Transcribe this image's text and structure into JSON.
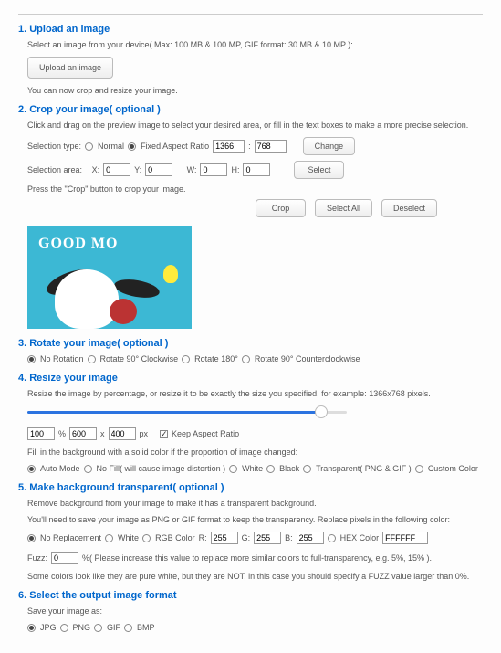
{
  "sec1": {
    "title": "1. Upload an image",
    "desc": "Select an image from your device( Max: 100 MB & 100 MP, GIF format: 30 MB & 10 MP ):",
    "btn": "Upload an image",
    "hint": "You can now crop and resize your image."
  },
  "sec2": {
    "title": "2. Crop your image( optional )",
    "desc": "Click and drag on the preview image to select your desired area, or fill in the text boxes to make a more precise selection.",
    "seltype_label": "Selection type:",
    "normal": "Normal",
    "fixed": "Fixed Aspect Ratio",
    "ar_w": "1366",
    "ar_h": "768",
    "sep": ":",
    "change_btn": "Change",
    "selarea_label": "Selection area:",
    "x_lbl": "X:",
    "y_lbl": "Y:",
    "w_lbl": "W:",
    "h_lbl": "H:",
    "x": "0",
    "y": "0",
    "w": "0",
    "h": "0",
    "select_btn": "Select",
    "press_hint": "Press the \"Crop\" button to crop your image.",
    "crop_btn": "Crop",
    "selall_btn": "Select All",
    "deselect_btn": "Deselect",
    "img_text": "GOOD MO"
  },
  "sec3": {
    "title": "3. Rotate your image( optional )",
    "opts": [
      "No Rotation",
      "Rotate 90° Clockwise",
      "Rotate 180°",
      "Rotate 90° Counterclockwise"
    ]
  },
  "sec4": {
    "title": "4. Resize your image",
    "desc": "Resize the image by percentage, or resize it to be exactly the size you specified, for example: 1366x768 pixels.",
    "pct": "100",
    "pct_lbl": "%",
    "rw": "600",
    "x_sep": "x",
    "rh": "400",
    "px_lbl": "px",
    "keep": "Keep Aspect Ratio",
    "hint2": "Fill in the background with a solid color if the proportion of image changed:",
    "opts": [
      "Auto Mode",
      "No Fill( will cause image distortion )",
      "White",
      "Black",
      "Transparent( PNG & GIF )",
      "Custom Color"
    ]
  },
  "sec5": {
    "title": "5. Make background transparent( optional )",
    "d1": "Remove background from your image to make it has a transparent background.",
    "d2": "You'll need to save your image as PNG or GIF format to keep the transparency. Replace pixels in the following color:",
    "noreplace": "No Replacement",
    "white": "White",
    "rgb_lbl": "RGB Color",
    "r_lbl": "R:",
    "g_lbl": "G:",
    "b_lbl": "B:",
    "r": "255",
    "g": "255",
    "b": "255",
    "hex_lbl": "HEX Color",
    "hex": "FFFFFF",
    "fuzz_lbl": "Fuzz:",
    "fuzz": "0",
    "fuzz_hint": "%( Please increase this value to replace more similar colors to full-transparency, e.g. 5%, 15% ).",
    "d3": "Some colors look like they are pure white, but they are NOT, in this case you should specify a FUZZ value larger than 0%."
  },
  "sec6": {
    "title": "6. Select the output image format",
    "d1": "Save your image as:",
    "opts": [
      "JPG",
      "PNG",
      "GIF",
      "BMP"
    ]
  }
}
